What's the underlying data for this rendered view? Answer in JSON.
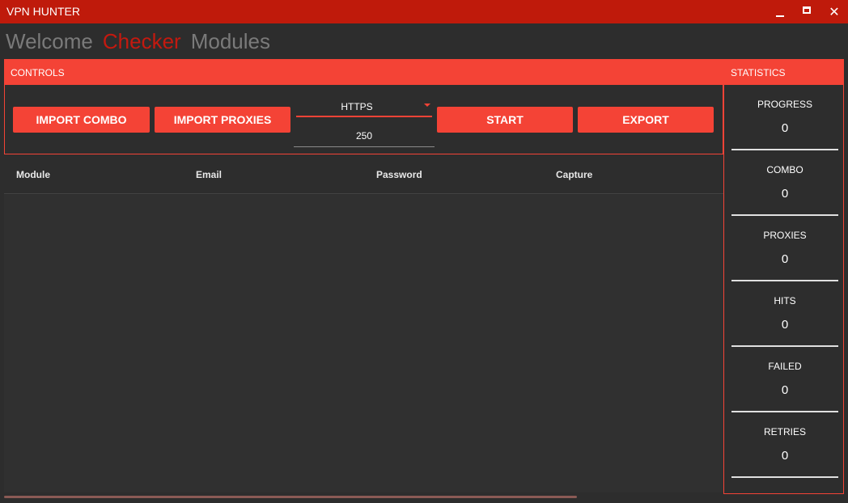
{
  "window": {
    "title": "VPN HUNTER",
    "minimize_icon": "minimize-icon",
    "maximize_icon": "maximize-icon",
    "close_glyph": "✕"
  },
  "nav": {
    "tabs": [
      {
        "label": "Welcome",
        "active": false
      },
      {
        "label": "Checker",
        "active": true
      },
      {
        "label": "Modules",
        "active": false
      }
    ]
  },
  "controls": {
    "header": "CONTROLS",
    "import_combo_label": "IMPORT COMBO",
    "import_proxies_label": "IMPORT PROXIES",
    "proxy_type_value": "HTTPS",
    "threads_value": "250",
    "start_label": "START",
    "export_label": "EXPORT"
  },
  "table": {
    "columns": [
      "Module",
      "Email",
      "Password",
      "Capture"
    ],
    "rows": []
  },
  "statistics": {
    "header": "STATISTICS",
    "items": [
      {
        "label": "PROGRESS",
        "value": "0"
      },
      {
        "label": "COMBO",
        "value": "0"
      },
      {
        "label": "PROXIES",
        "value": "0"
      },
      {
        "label": "HITS",
        "value": "0"
      },
      {
        "label": "FAILED",
        "value": "0"
      },
      {
        "label": "RETRIES",
        "value": "0"
      }
    ]
  },
  "colors": {
    "accent": "#f44336",
    "titlebar": "#bf1a0b",
    "background": "#2d2d2d",
    "active_tab": "#c4190f",
    "inactive_tab": "#7a7a7a"
  }
}
